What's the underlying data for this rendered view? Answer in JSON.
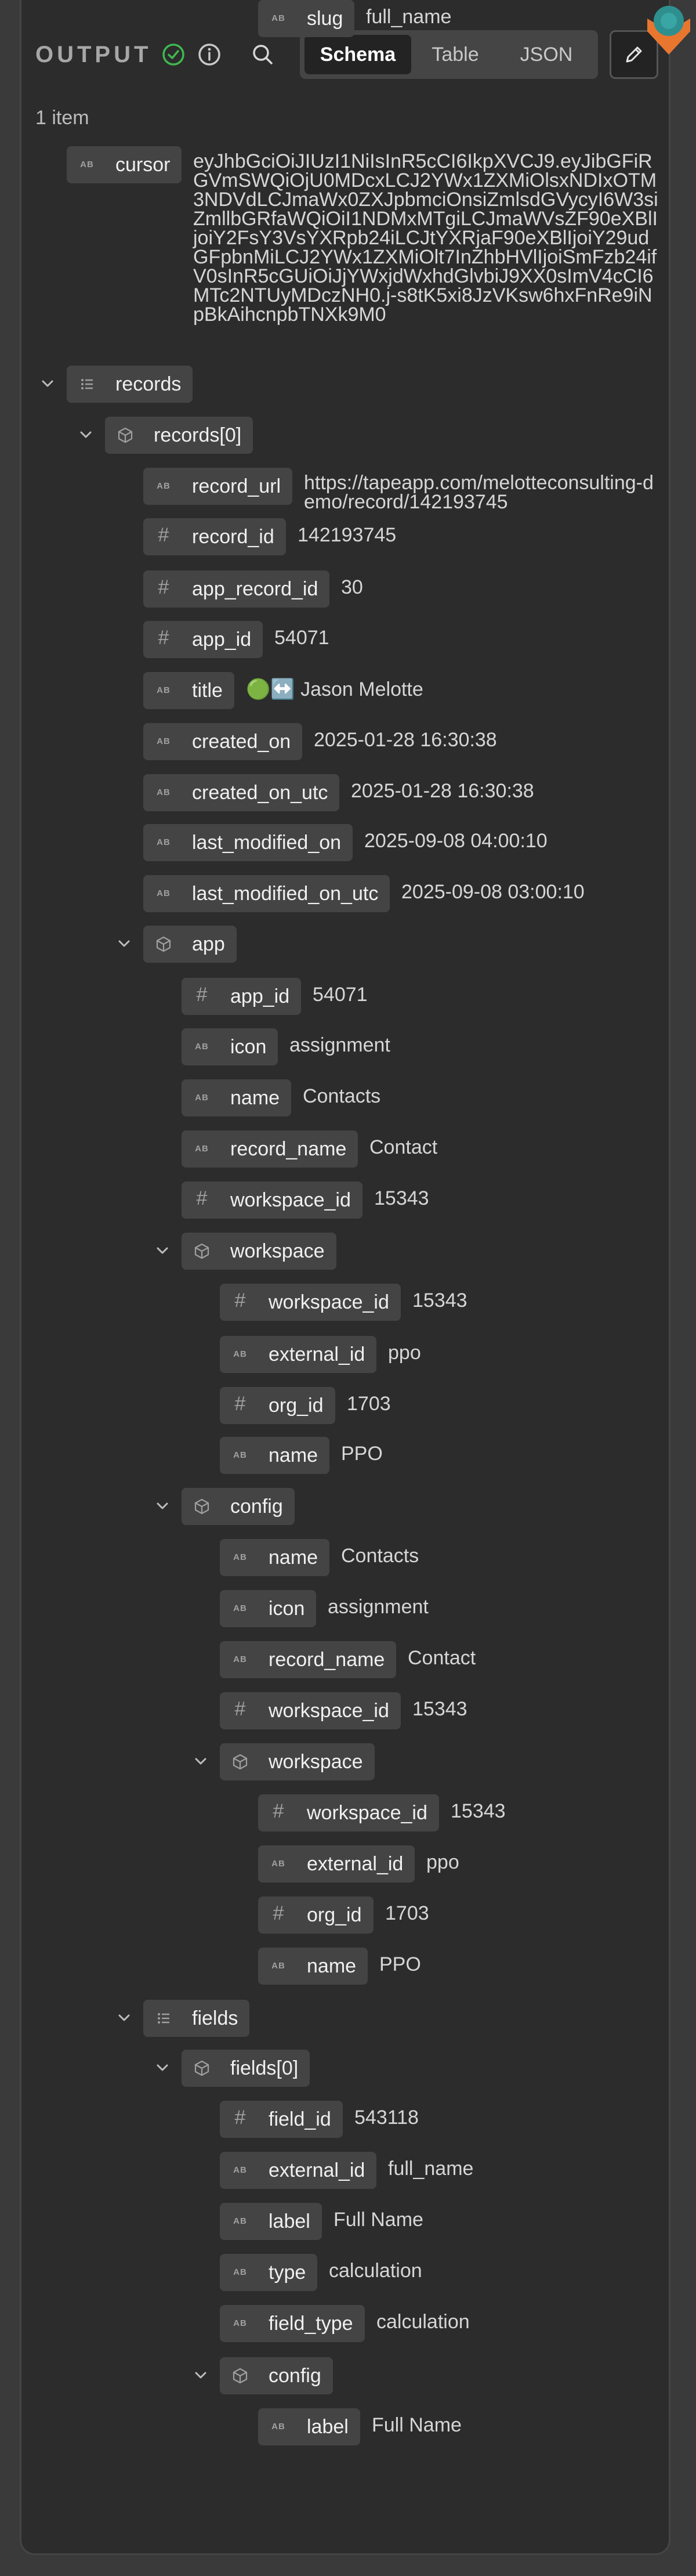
{
  "header": {
    "title": "OUTPUT",
    "tabs": [
      "Schema",
      "Table",
      "JSON"
    ],
    "active_tab": "Schema",
    "item_count": "1 item"
  },
  "colors": {
    "accent_green": "#3fb950",
    "chip_bg": "#444444",
    "panel_bg": "#2c2c2c",
    "badge_orange": "#e8762f",
    "badge_teal": "#2f8f8f"
  },
  "tree": [
    {
      "indent": 0,
      "kind": "string",
      "key": "cursor",
      "value": "eyJhbGciOiJIUzI1NiIsInR5cCI6IkpXVCJ9.eyJibGFiRGVmSWQiOjU0MDcxLCJ2YWx1ZXMiOlsxNDIxOTM3NDVdLCJmaWx0ZXJpbmciOnsiZmlsdGVycyI6W3siZmllbGRfaWQiOiI1NDMxMTgiLCJmaWVsZF90eXBlIjoiY2FsY3VsYXRpb24iLCJtYXRjaF90eXBlIjoiY29udGFpbnMiLCJ2YWx1ZXMiOlt7InZhbHVlIjoiSmFzb24ifV0sInR5cGUiOiJjYWxjdWxhdGlvbiJ9XX0sImV4cCI6MTc2NTUyMDczNH0.j-s8tK5xi8JzVKsw6hxFnRe9iNpBkAihcnpbTNXk9M0"
    },
    {
      "indent": 0,
      "kind": "list",
      "key": "records"
    },
    {
      "indent": 1,
      "kind": "object",
      "key": "records[0]"
    },
    {
      "indent": 2,
      "kind": "string",
      "key": "record_url",
      "value": "https://tapeapp.com/melotteconsulting-demo/record/142193745"
    },
    {
      "indent": 2,
      "kind": "number",
      "key": "record_id",
      "value": "142193745"
    },
    {
      "indent": 2,
      "kind": "number",
      "key": "app_record_id",
      "value": "30"
    },
    {
      "indent": 2,
      "kind": "number",
      "key": "app_id",
      "value": "54071"
    },
    {
      "indent": 2,
      "kind": "string",
      "key": "title",
      "value": "🟢↔️ Jason Melotte"
    },
    {
      "indent": 2,
      "kind": "string",
      "key": "created_on",
      "value": "2025-01-28 16:30:38"
    },
    {
      "indent": 2,
      "kind": "string",
      "key": "created_on_utc",
      "value": "2025-01-28 16:30:38"
    },
    {
      "indent": 2,
      "kind": "string",
      "key": "last_modified_on",
      "value": "2025-09-08 04:00:10"
    },
    {
      "indent": 2,
      "kind": "string",
      "key": "last_modified_on_utc",
      "value": "2025-09-08 03:00:10"
    },
    {
      "indent": 2,
      "kind": "object",
      "key": "app"
    },
    {
      "indent": 3,
      "kind": "number",
      "key": "app_id",
      "value": "54071"
    },
    {
      "indent": 3,
      "kind": "string",
      "key": "icon",
      "value": "assignment"
    },
    {
      "indent": 3,
      "kind": "string",
      "key": "name",
      "value": "Contacts"
    },
    {
      "indent": 3,
      "kind": "string",
      "key": "record_name",
      "value": "Contact"
    },
    {
      "indent": 3,
      "kind": "number",
      "key": "workspace_id",
      "value": "15343"
    },
    {
      "indent": 3,
      "kind": "object",
      "key": "workspace"
    },
    {
      "indent": 4,
      "kind": "number",
      "key": "workspace_id",
      "value": "15343"
    },
    {
      "indent": 4,
      "kind": "string",
      "key": "external_id",
      "value": "ppo"
    },
    {
      "indent": 4,
      "kind": "number",
      "key": "org_id",
      "value": "1703"
    },
    {
      "indent": 4,
      "kind": "string",
      "key": "name",
      "value": "PPO"
    },
    {
      "indent": 3,
      "kind": "object",
      "key": "config"
    },
    {
      "indent": 4,
      "kind": "string",
      "key": "name",
      "value": "Contacts"
    },
    {
      "indent": 4,
      "kind": "string",
      "key": "icon",
      "value": "assignment"
    },
    {
      "indent": 4,
      "kind": "string",
      "key": "record_name",
      "value": "Contact"
    },
    {
      "indent": 4,
      "kind": "number",
      "key": "workspace_id",
      "value": "15343"
    },
    {
      "indent": 4,
      "kind": "object",
      "key": "workspace"
    },
    {
      "indent": 5,
      "kind": "number",
      "key": "workspace_id",
      "value": "15343"
    },
    {
      "indent": 5,
      "kind": "string",
      "key": "external_id",
      "value": "ppo"
    },
    {
      "indent": 5,
      "kind": "number",
      "key": "org_id",
      "value": "1703"
    },
    {
      "indent": 5,
      "kind": "string",
      "key": "name",
      "value": "PPO"
    },
    {
      "indent": 2,
      "kind": "list",
      "key": "fields"
    },
    {
      "indent": 3,
      "kind": "object",
      "key": "fields[0]"
    },
    {
      "indent": 4,
      "kind": "number",
      "key": "field_id",
      "value": "543118"
    },
    {
      "indent": 4,
      "kind": "string",
      "key": "external_id",
      "value": "full_name"
    },
    {
      "indent": 4,
      "kind": "string",
      "key": "label",
      "value": "Full Name"
    },
    {
      "indent": 4,
      "kind": "string",
      "key": "type",
      "value": "calculation"
    },
    {
      "indent": 4,
      "kind": "string",
      "key": "field_type",
      "value": "calculation"
    },
    {
      "indent": 4,
      "kind": "object",
      "key": "config"
    },
    {
      "indent": 5,
      "kind": "string",
      "key": "label",
      "value": "Full Name"
    },
    {
      "indent": 5,
      "kind": "string",
      "key": "slug",
      "value": "full_name"
    }
  ]
}
